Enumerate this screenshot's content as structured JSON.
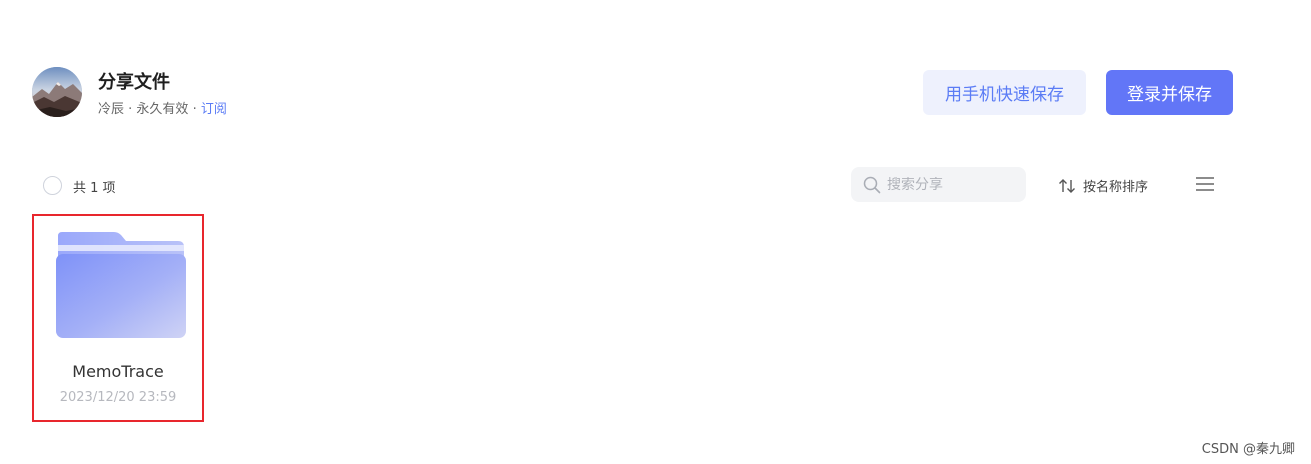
{
  "share": {
    "title": "分享文件",
    "owner": "冷辰",
    "separator": " · ",
    "validity": "永久有效",
    "subscribe_label": "订阅"
  },
  "buttons": {
    "mobile_save_label": "用手机快速保存",
    "login_save_label": "登录并保存"
  },
  "toolbar": {
    "count_label": "共 1 项",
    "search_placeholder": "搜索分享",
    "sort_label": "按名称排序"
  },
  "files": [
    {
      "name": "MemoTrace",
      "date": "2023/12/20 23:59",
      "icon": "folder-icon"
    }
  ],
  "watermark": "CSDN @秦九卿",
  "colors": {
    "accent": "#6276f7",
    "accent_light_bg": "#eef1fd",
    "highlight_border": "#e8262d",
    "folder_front": "#8a9cf9"
  }
}
